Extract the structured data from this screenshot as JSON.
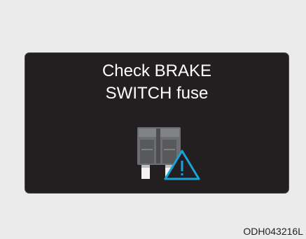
{
  "warning": {
    "line1": "Check BRAKE",
    "line2": "SWITCH fuse",
    "icons": [
      "fuse-icon",
      "warning-triangle-icon"
    ],
    "accent_color": "#1aa3d9"
  },
  "image_code": "ODH043216L"
}
